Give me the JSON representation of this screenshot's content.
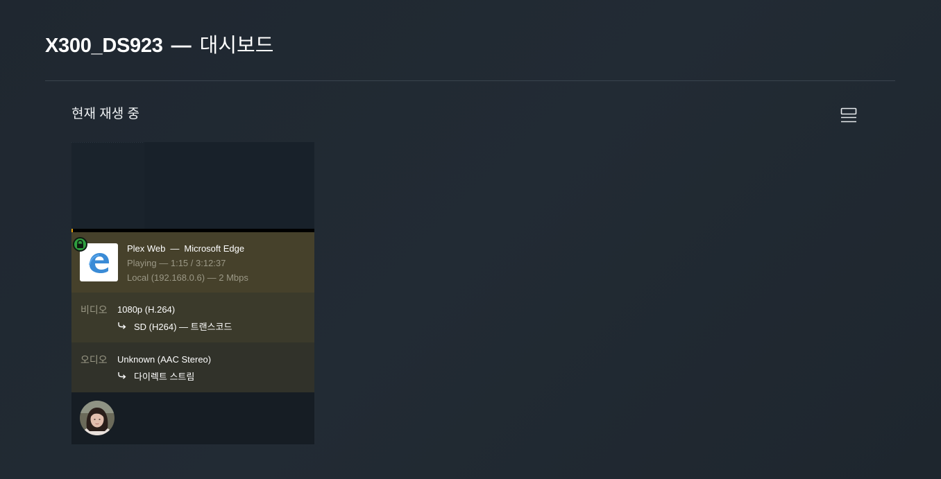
{
  "header": {
    "server_name": "X300_DS923",
    "separator": "—",
    "page_label": "대시보드"
  },
  "now_playing": {
    "section_title": "현재 재생 중",
    "view_toggle_icon": "list-view-icon"
  },
  "session": {
    "progress_fraction": 0.0066,
    "secure_icon": "lock-icon",
    "app_icon": "edge-browser-icon",
    "player": "Plex Web",
    "player_sep": "—",
    "platform": "Microsoft Edge",
    "state_line": "Playing — 1:15 / 3:12:37",
    "network_line": "Local (192.168.0.6) — 2 Mbps",
    "video": {
      "label": "비디오",
      "source": "1080p (H.264)",
      "decision_icon": "redirect-arrow-icon",
      "decision": "SD (H264) — 트랜스코드"
    },
    "audio": {
      "label": "오디오",
      "source": "Unknown (AAC Stereo)",
      "decision_icon": "redirect-arrow-icon",
      "decision": "다이렉트 스트림"
    },
    "user_avatar": "user-avatar"
  },
  "colors": {
    "background": "#1f2933",
    "card_player": "#46412b",
    "card_video": "#3b3a2b",
    "card_audio": "#31322a",
    "card_user": "#161d24",
    "progress": "#e5a00d",
    "secure": "#2f9e3f",
    "edge_blue": "#3a8bd6"
  }
}
